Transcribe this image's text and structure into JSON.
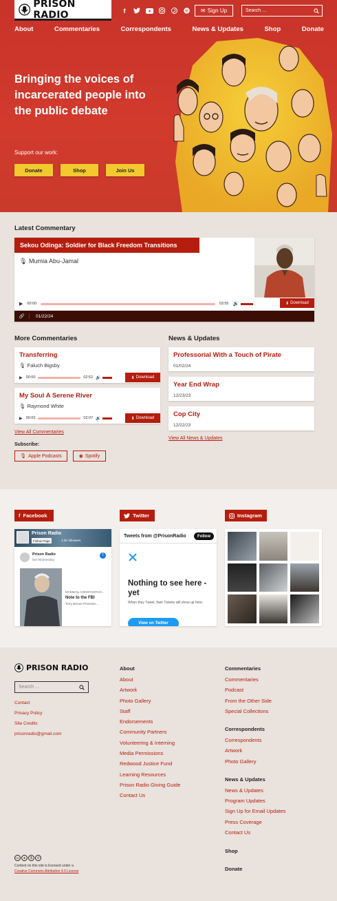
{
  "header": {
    "logo_text": "PRISON RADIO",
    "signup_label": "Sign Up",
    "search_placeholder": "Search ...",
    "social_icons": [
      "facebook-icon",
      "twitter-icon",
      "youtube-icon",
      "instagram-icon",
      "pinterest-icon",
      "spotify-icon"
    ]
  },
  "nav": [
    "About",
    "Commentaries",
    "Correspondents",
    "News & Updates",
    "Shop",
    "Donate"
  ],
  "hero": {
    "title": "Bringing the voices of incarcerated people into the public debate",
    "support_label": "Support our work:",
    "buttons": [
      "Donate",
      "Shop",
      "Join Us"
    ]
  },
  "latest": {
    "heading": "Latest Commentary",
    "title": "Sekou Odinga: Soldier for Black Freedom Transitions",
    "author": "Mumia Abu-Jamal",
    "time_current": "00:00",
    "time_total": "03:55",
    "download_label": "Download",
    "date": "01/22/24"
  },
  "more": {
    "heading": "More Commentaries",
    "items": [
      {
        "title": "Transferring",
        "author": "Faluch Bigsby",
        "current": "00:00",
        "total": "02:52",
        "download": "Download"
      },
      {
        "title": "My Soul A Serene River",
        "author": "Raymond White",
        "current": "00:00",
        "total": "02:07",
        "download": "Download"
      }
    ],
    "view_all": "View All Commentaries",
    "subscribe_label": "Subscribe:",
    "subscribe_buttons": [
      "Apple Podcasts",
      "Spotify"
    ]
  },
  "news": {
    "heading": "News & Updates",
    "items": [
      {
        "title": "Professorial With a Touch of Pirate",
        "date": "01/02/24"
      },
      {
        "title": "Year End Wrap",
        "date": "12/23/23"
      },
      {
        "title": "Cop City",
        "date": "12/22/23"
      }
    ],
    "view_all": "View All News & Updates"
  },
  "social": {
    "facebook_label": "Facebook",
    "twitter_label": "Twitter",
    "instagram_label": "Instagram",
    "fb": {
      "page_name": "Prison Radio",
      "follow_label": "Follow Page",
      "followers": "2.2K followers",
      "post_name": "Prison Radio",
      "post_time": "last Wednesday",
      "post_source": "MYEMAIL.CONSTANTCO...",
      "post_title": "Note to the FBI",
      "post_sub": "Terry Bisson Presente..."
    },
    "tw": {
      "header": "Tweets from @PrisonRadio",
      "follow": "Follow",
      "empty_title": "Nothing to see here - yet",
      "empty_text": "When they Tweet, their Tweets will show up here.",
      "view_button": "View on Twitter"
    }
  },
  "footer": {
    "logo_text": "PRISON RADIO",
    "search_placeholder": "Search ...",
    "links": [
      "Contact",
      "Privacy Policy",
      "Site Credits",
      "prisonradio@gmail.com"
    ],
    "license_text": "Content on this site is licensed under a",
    "license_link": "Creative Commons Attribution 4.0 License",
    "about_head": "About",
    "about_items": [
      "About",
      "Artwork",
      "Photo Gallery",
      "Staff",
      "Endorsements",
      "Community Partners",
      "Volunteering & Interning",
      "Media Permissions",
      "Redwood Justice Fund",
      "Learning Resources",
      "Prison Radio Giving Guide",
      "Contact Us"
    ],
    "commentaries_head": "Commentaries",
    "commentaries_items": [
      "Commentaries",
      "Podcast",
      "From the Other Side",
      "Special Collections"
    ],
    "correspondents_head": "Correspondents",
    "correspondents_items": [
      "Correspondents",
      "Artwork",
      "Photo Gallery"
    ],
    "news_head": "News & Updates",
    "news_items": [
      "News & Updates",
      "Program Updates",
      "Sign Up for Email Updates",
      "Press Coverage",
      "Contact Us"
    ],
    "shop_head": "Shop",
    "donate_head": "Donate"
  },
  "colors": {
    "brand_red": "#b51d0e",
    "hero_red": "#cc362b",
    "accent_yellow": "#f4c930"
  }
}
